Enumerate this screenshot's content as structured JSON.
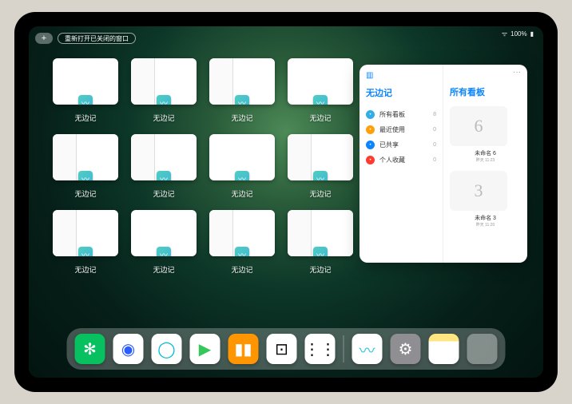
{
  "status": {
    "wifi": "wifi-icon",
    "battery": "100%"
  },
  "top": {
    "plus_label": "+",
    "reopen_label": "重新打开已关闭的窗口"
  },
  "app_name": "无边记",
  "windows": [
    {
      "label": "无边记",
      "variant": "blank"
    },
    {
      "label": "无边记",
      "variant": "split"
    },
    {
      "label": "无边记",
      "variant": "split"
    },
    {
      "label": "无边记",
      "variant": "blank"
    },
    {
      "label": "无边记",
      "variant": "split"
    },
    {
      "label": "无边记",
      "variant": "split"
    },
    {
      "label": "无边记",
      "variant": "blank"
    },
    {
      "label": "无边记",
      "variant": "split"
    },
    {
      "label": "无边记",
      "variant": "split"
    },
    {
      "label": "无边记",
      "variant": "blank"
    },
    {
      "label": "无边记",
      "variant": "split"
    },
    {
      "label": "无边记",
      "variant": "split"
    }
  ],
  "popover": {
    "sidebar_title": "无边记",
    "main_title": "所有看板",
    "more": "···",
    "items": [
      {
        "icon": "grid",
        "color": "#32ade6",
        "label": "所有看板",
        "count": 8
      },
      {
        "icon": "clock",
        "color": "#ff9f0a",
        "label": "最近使用",
        "count": 0
      },
      {
        "icon": "person",
        "color": "#0a84ff",
        "label": "已共享",
        "count": 0
      },
      {
        "icon": "heart",
        "color": "#ff3b30",
        "label": "个人收藏",
        "count": 0
      }
    ],
    "boards": [
      {
        "glyph": "6",
        "label": "未命名 6",
        "sub": "昨天 11:23"
      },
      {
        "glyph": "3",
        "label": "未命名 3",
        "sub": "昨天 11:20"
      }
    ]
  },
  "dock": {
    "apps": [
      {
        "name": "wechat",
        "bg": "#07c160",
        "glyph": "✻"
      },
      {
        "name": "quark-blue",
        "bg": "#ffffff",
        "glyph": "◉",
        "fg": "#2b5cff"
      },
      {
        "name": "quark-cyan",
        "bg": "#ffffff",
        "glyph": "◯",
        "fg": "#00bcd4"
      },
      {
        "name": "play",
        "bg": "#ffffff",
        "glyph": "▶",
        "fg": "#34c759"
      },
      {
        "name": "books",
        "bg": "#ff9500",
        "glyph": "▮▮"
      },
      {
        "name": "dice",
        "bg": "#ffffff",
        "glyph": "⊡",
        "fg": "#000"
      },
      {
        "name": "dots",
        "bg": "#ffffff",
        "glyph": "⋮⋮",
        "fg": "#000"
      },
      {
        "name": "freeform",
        "bg": "#ffffff",
        "glyph": "〰",
        "fg": "#34c6e0"
      },
      {
        "name": "settings",
        "bg": "#8e8e93",
        "glyph": "⚙"
      },
      {
        "name": "notes",
        "bg": "#ffffff",
        "glyph": "",
        "notes": true
      }
    ]
  }
}
